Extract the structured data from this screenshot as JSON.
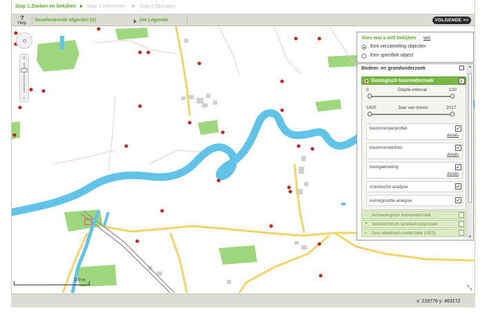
{
  "steps": {
    "step1": "Stap 1:Zoeken en bekijken",
    "step2": "Stap 2:Selecteren",
    "step3": "Stap 3:Opvragen"
  },
  "toolbar": {
    "help_label": "Help",
    "help_symbol": "?",
    "selected_objects": "Geselecteerde objecten (0)",
    "legend": "Uw Legenda",
    "next_button": "VOLGENDE >>"
  },
  "map": {
    "scale_label": "300 m",
    "river_color": "#62c3e8",
    "road_color": "#f3d466",
    "field_color": "#9fd77f",
    "marker_color": "#d6221b"
  },
  "chooser": {
    "title": "Kies wat u wilt bekijken",
    "wis": "wis",
    "options": [
      {
        "label": "Een verzameling objecten",
        "selected": true
      },
      {
        "label": "Een specifiek object",
        "selected": false
      }
    ]
  },
  "layers": {
    "title": "Bodem- en grondonderzoek",
    "active_category": "Geologisch booronderzoek",
    "depth": {
      "title": "Diepte-interval",
      "min": "0",
      "max": "120"
    },
    "year": {
      "title": "Jaar van boren",
      "min": "1900",
      "max": "2017"
    },
    "items": [
      {
        "label": "boormonsterprofiel",
        "detail": "details",
        "checked": true
      },
      {
        "label": "boormonsterfoto",
        "detail": "details",
        "checked": true
      },
      {
        "label": "boorgatmeting",
        "detail": "details",
        "checked": true
      },
      {
        "label": "chemische analyse",
        "checked": true
      },
      {
        "label": "korrelgrootte-analyse",
        "checked": true
      }
    ],
    "categories": [
      {
        "label": "Archeologisch booronderzoek",
        "icon": "○"
      },
      {
        "label": "Geotechnisch sondeeronderzoek",
        "icon": "▼"
      },
      {
        "label": "Geo-elektrisch onderzoek (VES)",
        "icon": "━"
      }
    ],
    "check_symbol": "✓"
  },
  "footer": {
    "coordinates": "x: 216776  y: 463172"
  }
}
